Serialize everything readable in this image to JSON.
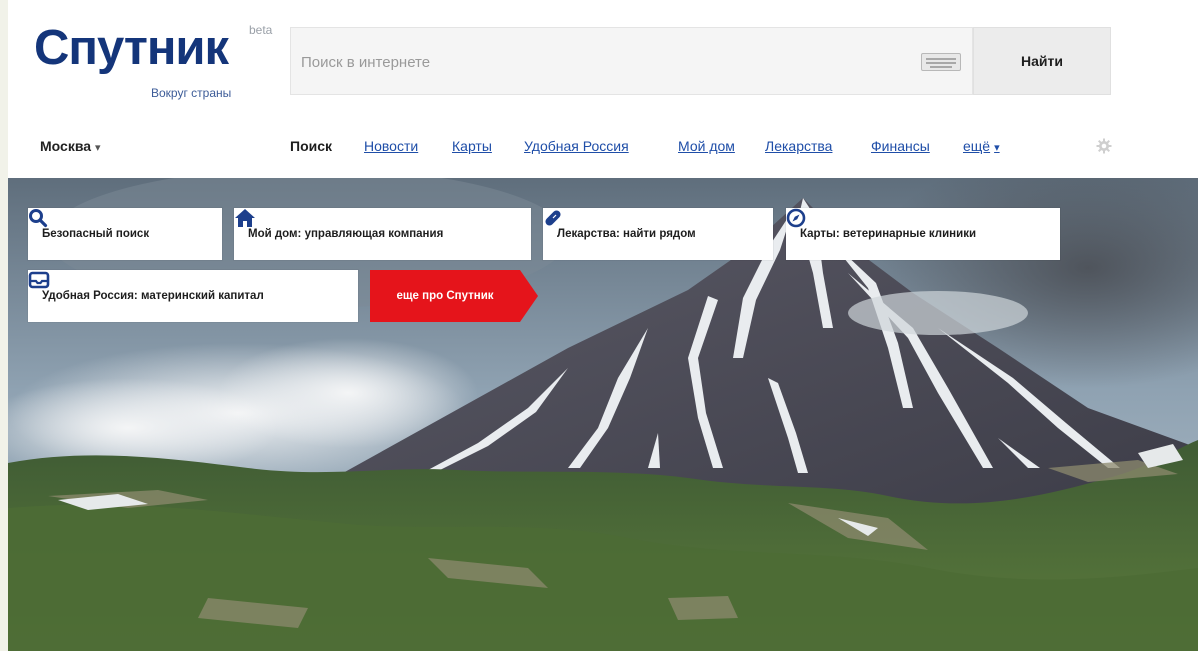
{
  "logo": {
    "name": "Спутник",
    "beta": "beta",
    "tagline": "Вокруг страны"
  },
  "search": {
    "placeholder": "Поиск в интернете",
    "button_label": "Найти"
  },
  "city": {
    "label": "Москва"
  },
  "nav": {
    "items": [
      {
        "label": "Поиск",
        "active": true
      },
      {
        "label": "Новости"
      },
      {
        "label": "Карты"
      },
      {
        "label": "Удобная Россия"
      },
      {
        "label": "Мой дом"
      },
      {
        "label": "Лекарства"
      },
      {
        "label": "Финансы"
      },
      {
        "label": "ещё"
      }
    ]
  },
  "tiles": [
    {
      "label": "Безопасный поиск",
      "icon": "search-icon"
    },
    {
      "label": "Мой дом: управляющая компания",
      "icon": "home-icon"
    },
    {
      "label": "Лекарства: найти рядом",
      "icon": "pill-icon"
    },
    {
      "label": "Карты: ветеринарные клиники",
      "icon": "compass-icon"
    },
    {
      "label": "Удобная Россия: материнский капитал",
      "icon": "mail-icon"
    }
  ],
  "promo": {
    "label": "еще про Спутник"
  },
  "colors": {
    "brand": "#14357a",
    "link": "#1f4ea8",
    "promo": "#e5141b",
    "icon": "#1d3f8c"
  }
}
